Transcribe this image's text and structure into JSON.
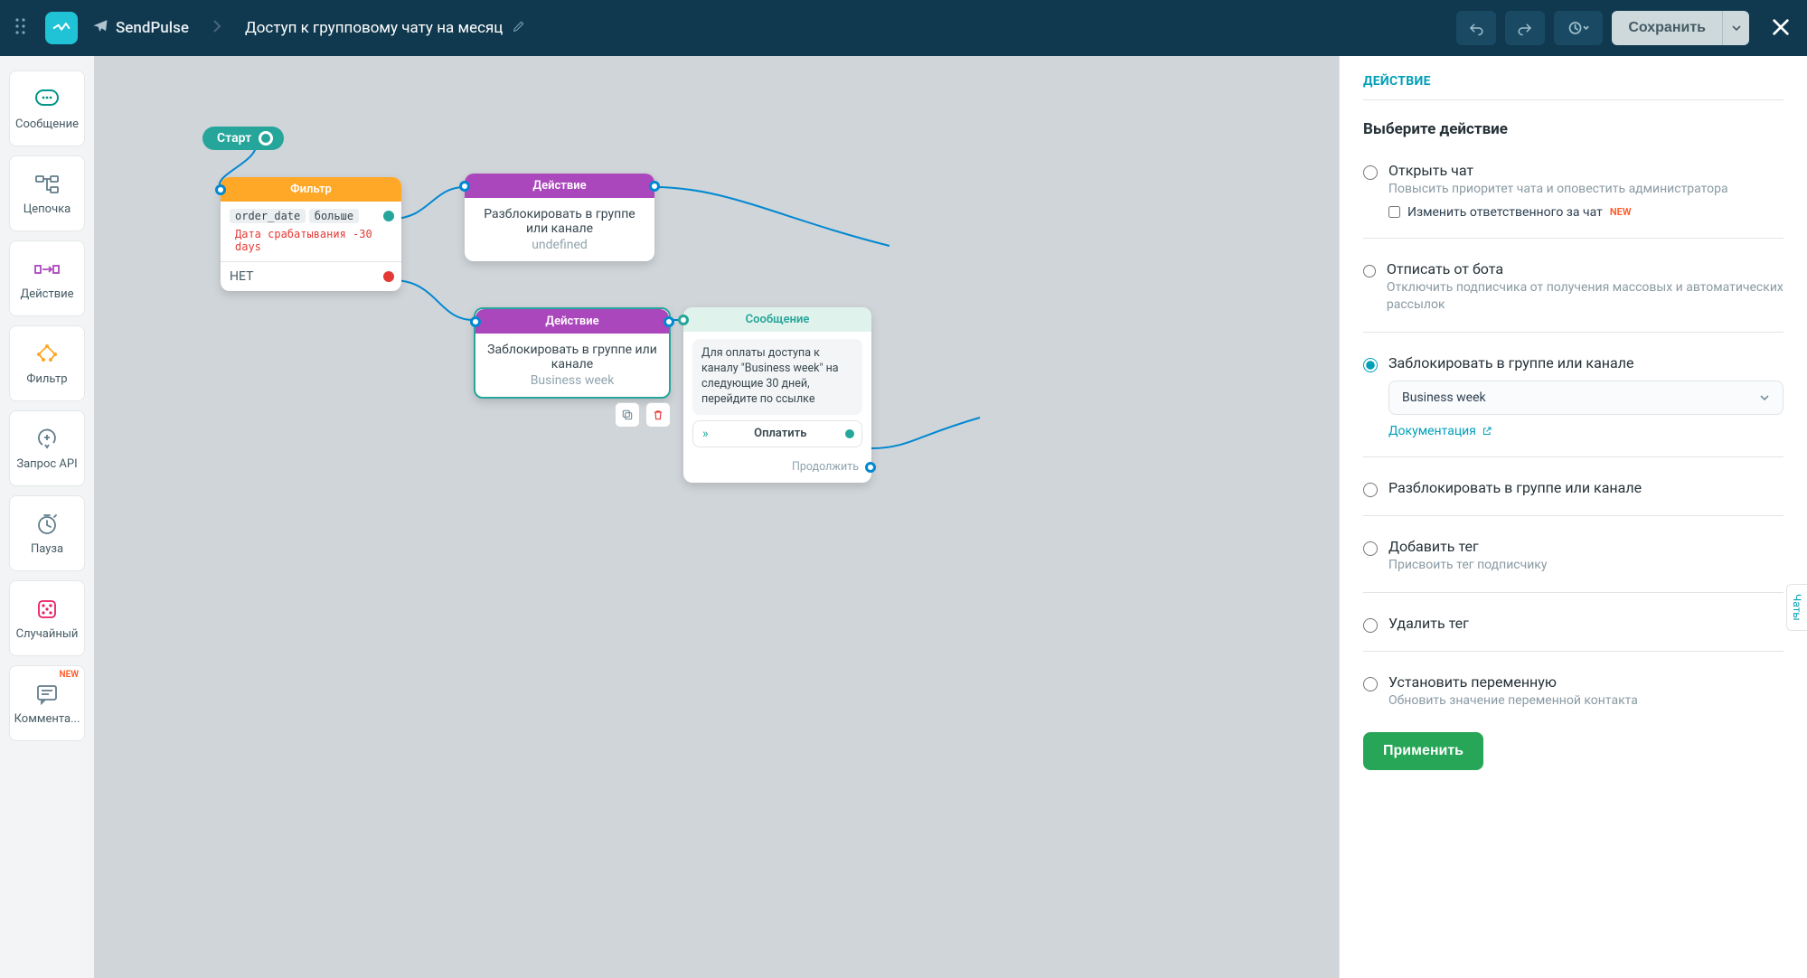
{
  "header": {
    "brand": "SendPulse",
    "flow_title": "Доступ к групповому чату на месяц",
    "save_label": "Сохранить"
  },
  "toolbar": {
    "message": "Сообщение",
    "flow": "Цепочка",
    "action": "Действие",
    "filter": "Фильтр",
    "api": "Запрос API",
    "pause": "Пауза",
    "random": "Случайный",
    "comment": "Коммента...",
    "new_badge": "NEW"
  },
  "canvas": {
    "start": "Старт",
    "filter": {
      "title": "Фильтр",
      "var": "order_date",
      "op": "больше",
      "date_expr": "Дата срабатывания -30 days",
      "no_label": "НЕТ"
    },
    "action1": {
      "title": "Действие",
      "line1": "Разблокировать в группе или канале",
      "sub": "undefined"
    },
    "action2": {
      "title": "Действие",
      "line1": "Заблокировать в группе или канале",
      "sub": "Business week"
    },
    "message": {
      "title": "Сообщение",
      "text": "Для оплаты доступа к каналу \"Business week\" на следующие 30 дней, перейдите по ссылке",
      "button": "Оплатить",
      "continue": "Продолжить"
    }
  },
  "panel": {
    "heading": "ДЕЙСТВИЕ",
    "subheading": "Выберите действие",
    "opt_open": {
      "title": "Открыть чат",
      "desc": "Повысить приоритет чата и оповестить администратора",
      "sub": "Изменить ответственного за чат",
      "newtag": "NEW"
    },
    "opt_unsub": {
      "title": "Отписать от бота",
      "desc": "Отключить подписчика от получения массовых и автоматических рассылок"
    },
    "opt_block": {
      "title": "Заблокировать в группе или канале",
      "select_value": "Business week",
      "doc": "Документация"
    },
    "opt_unblock": {
      "title": "Разблокировать в группе или канале"
    },
    "opt_addtag": {
      "title": "Добавить тег",
      "desc": "Присвоить тег подписчику"
    },
    "opt_deltag": {
      "title": "Удалить тег"
    },
    "opt_setvar": {
      "title": "Установить переменную",
      "desc": "Обновить значение переменной контакта"
    },
    "apply": "Применить"
  },
  "chats_tab": "Чаты"
}
